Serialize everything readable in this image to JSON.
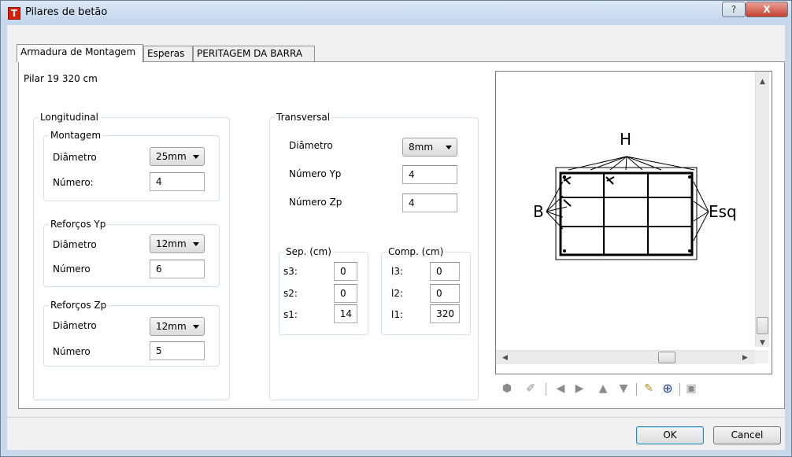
{
  "window": {
    "icon_letter": "T",
    "title": "Pilares de betão",
    "help_label": "?",
    "close_label": "X"
  },
  "tabs": [
    {
      "label": "Armadura de Montagem",
      "active": true
    },
    {
      "label": "Esperas",
      "active": false
    },
    {
      "label": "PERITAGEM DA BARRA",
      "active": false
    }
  ],
  "pilar_info": "Pilar 19  320 cm",
  "longitudinal": {
    "title": "Longitudinal",
    "montagem": {
      "title": "Montagem",
      "diametro_label": "Diâmetro",
      "diametro_value": "25mm",
      "numero_label": "Número:",
      "numero_value": "4"
    },
    "reforcos_yp": {
      "title": "Reforços Yp",
      "diametro_label": "Diâmetro",
      "diametro_value": "12mm",
      "numero_label": "Número",
      "numero_value": "6"
    },
    "reforcos_zp": {
      "title": "Reforços Zp",
      "diametro_label": "Diâmetro",
      "diametro_value": "12mm",
      "numero_label": "Número",
      "numero_value": "5"
    }
  },
  "transversal": {
    "title": "Transversal",
    "diametro_label": "Diâmetro",
    "diametro_value": "8mm",
    "numero_yp_label": "Número Yp",
    "numero_yp_value": "4",
    "numero_zp_label": "Número Zp",
    "numero_zp_value": "4",
    "sep": {
      "title": "Sep. (cm)",
      "s3_label": "s3:",
      "s3_value": "0",
      "s2_label": "s2:",
      "s2_value": "0",
      "s1_label": "s1:",
      "s1_value": "14"
    },
    "comp": {
      "title": "Comp. (cm)",
      "l3_label": "l3:",
      "l3_value": "0",
      "l2_label": "l2:",
      "l2_value": "0",
      "l1_label": "l1:",
      "l1_value": "320"
    }
  },
  "preview": {
    "label_h": "H",
    "label_b": "B",
    "label_esq": "Esq"
  },
  "toolbar_icons": [
    "hexagon-icon",
    "edit-icon",
    "arrow-left-icon",
    "arrow-right-icon",
    "arrow-up-icon",
    "arrow-down-icon",
    "pencil-check-icon",
    "zoom-icon",
    "save-icon"
  ],
  "buttons": {
    "ok": "OK",
    "cancel": "Cancel"
  }
}
